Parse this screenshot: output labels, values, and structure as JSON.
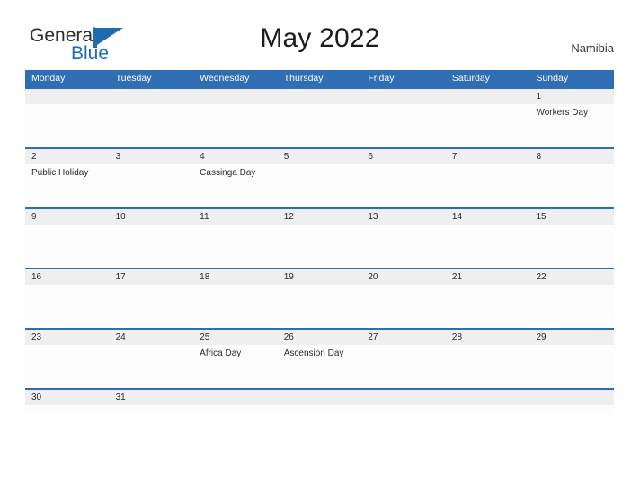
{
  "brand": {
    "name_part1": "General",
    "name_part2": "Blue",
    "mark": "blue-flag-triangle"
  },
  "header": {
    "title": "May 2022",
    "region": "Namibia"
  },
  "colors": {
    "header_blue": "#2f6eb5",
    "row_divider_blue": "#2f6eb5",
    "number_strip_gray": "#efefef",
    "logo_blue": "#1f6bb0",
    "text_dark": "#2b2b2b"
  },
  "calendar": {
    "weekday_headers": [
      "Monday",
      "Tuesday",
      "Wednesday",
      "Thursday",
      "Friday",
      "Saturday",
      "Sunday"
    ],
    "weeks": [
      {
        "days": [
          {
            "number": "",
            "event": ""
          },
          {
            "number": "",
            "event": ""
          },
          {
            "number": "",
            "event": ""
          },
          {
            "number": "",
            "event": ""
          },
          {
            "number": "",
            "event": ""
          },
          {
            "number": "",
            "event": ""
          },
          {
            "number": "1",
            "event": "Workers Day"
          }
        ]
      },
      {
        "days": [
          {
            "number": "2",
            "event": "Public Holiday"
          },
          {
            "number": "3",
            "event": ""
          },
          {
            "number": "4",
            "event": "Cassinga Day"
          },
          {
            "number": "5",
            "event": ""
          },
          {
            "number": "6",
            "event": ""
          },
          {
            "number": "7",
            "event": ""
          },
          {
            "number": "8",
            "event": ""
          }
        ]
      },
      {
        "days": [
          {
            "number": "9",
            "event": ""
          },
          {
            "number": "10",
            "event": ""
          },
          {
            "number": "11",
            "event": ""
          },
          {
            "number": "12",
            "event": ""
          },
          {
            "number": "13",
            "event": ""
          },
          {
            "number": "14",
            "event": ""
          },
          {
            "number": "15",
            "event": ""
          }
        ]
      },
      {
        "days": [
          {
            "number": "16",
            "event": ""
          },
          {
            "number": "17",
            "event": ""
          },
          {
            "number": "18",
            "event": ""
          },
          {
            "number": "19",
            "event": ""
          },
          {
            "number": "20",
            "event": ""
          },
          {
            "number": "21",
            "event": ""
          },
          {
            "number": "22",
            "event": ""
          }
        ]
      },
      {
        "days": [
          {
            "number": "23",
            "event": ""
          },
          {
            "number": "24",
            "event": ""
          },
          {
            "number": "25",
            "event": "Africa Day"
          },
          {
            "number": "26",
            "event": "Ascension Day"
          },
          {
            "number": "27",
            "event": ""
          },
          {
            "number": "28",
            "event": ""
          },
          {
            "number": "29",
            "event": ""
          }
        ]
      },
      {
        "days": [
          {
            "number": "30",
            "event": ""
          },
          {
            "number": "31",
            "event": ""
          },
          {
            "number": "",
            "event": ""
          },
          {
            "number": "",
            "event": ""
          },
          {
            "number": "",
            "event": ""
          },
          {
            "number": "",
            "event": ""
          },
          {
            "number": "",
            "event": ""
          }
        ]
      }
    ]
  }
}
